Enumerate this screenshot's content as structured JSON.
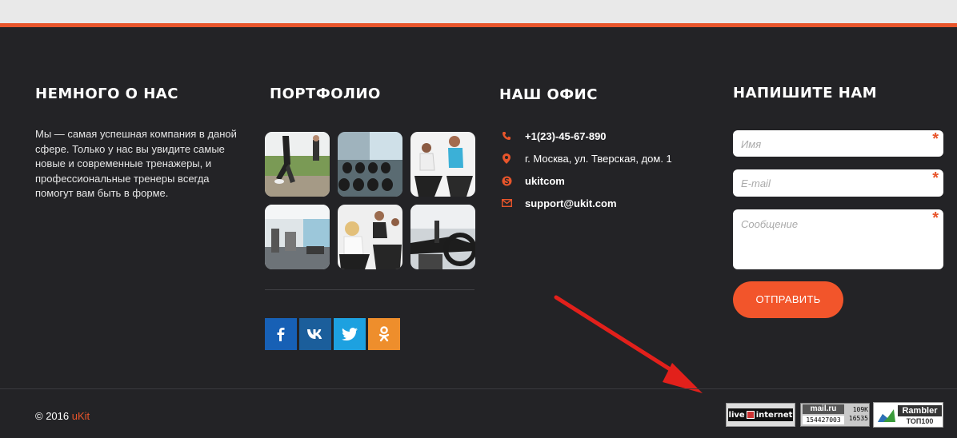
{
  "columns": {
    "about": {
      "title": "НЕМНОГО О НАС",
      "text": "Мы — самая успешная компания в даной сфере. Только у нас вы увидите самые новые и современные тренажеры, и профессиональные тренеры всегда помогут вам быть в форме."
    },
    "portfolio": {
      "title": "ПОРТФОЛИО",
      "thumbnails": [
        "runners",
        "dumbbell-rack",
        "spin-class",
        "gym-hall",
        "bike-class",
        "treadmill-closeup"
      ],
      "social": [
        {
          "name": "facebook",
          "glyph": "f",
          "color": "#1760b5"
        },
        {
          "name": "vk",
          "glyph": "vk",
          "color": "#1b5e9b"
        },
        {
          "name": "twitter",
          "glyph": "twitter",
          "color": "#1da1e0"
        },
        {
          "name": "odnoklassniki",
          "glyph": "ok",
          "color": "#ee8e2c"
        }
      ]
    },
    "office": {
      "title": "НАШ ОФИС",
      "phone": "+1(23)-45-67-890",
      "address": "г. Москва, ул. Тверская, дом. 1",
      "skype": "ukitcom",
      "email": "support@ukit.com"
    },
    "contact": {
      "title": "НАПИШИТЕ НАМ",
      "name_placeholder": "Имя",
      "email_placeholder": "E-mail",
      "message_placeholder": "Сообщение",
      "required_mark": "*",
      "send_label": "ОТПРАВИТЬ"
    }
  },
  "bottom": {
    "copyright_prefix": "© 2016",
    "brand": "uKit",
    "counters": {
      "liveinternet": {
        "left": "live",
        "right": "internet"
      },
      "mailru": {
        "logo": "mail.ru",
        "total": "154427003",
        "day": "109K",
        "visitors": "16535"
      },
      "rambler": {
        "logo": "Rambler",
        "sub": "ТОП100"
      }
    }
  },
  "colors": {
    "accent": "#e8552b",
    "background": "#232326",
    "button": "#f2552b"
  }
}
